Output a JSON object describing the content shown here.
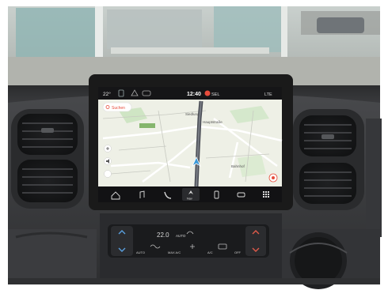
{
  "status_bar": {
    "temperature": "22°",
    "time": "12:40",
    "mode_badge": "SEL",
    "right_text": "LTE",
    "icons": [
      "bluetooth-icon",
      "warning-icon",
      "car-icon",
      "signal-icon",
      "battery-icon"
    ]
  },
  "map": {
    "search_label": "Suchen",
    "road_labels": [
      "Siedlung",
      "Hauptstraße",
      "Bahnhof"
    ],
    "zoom_label": "Nav",
    "compass": "N"
  },
  "bottom_dock": {
    "icons": [
      "home-icon",
      "music-icon",
      "phone-icon",
      "navigation-icon",
      "mobile-icon",
      "car-icon",
      "apps-icon"
    ]
  },
  "climate_panel": {
    "temperature": "22.0",
    "mode": "AUTO",
    "buttons": [
      "AUTO",
      "MAX A/C",
      "A/C",
      "OFF"
    ],
    "icons": [
      "seat-heat-icon",
      "fan-icon",
      "defrost-icon",
      "rear-defrost-icon"
    ]
  },
  "colors": {
    "accent_red": "#e74c3c",
    "nav_blue": "#3a9ad9",
    "map_bg": "#eef0e6",
    "screen_frame": "#1a1a1a",
    "dash": "#3a3b3d"
  }
}
